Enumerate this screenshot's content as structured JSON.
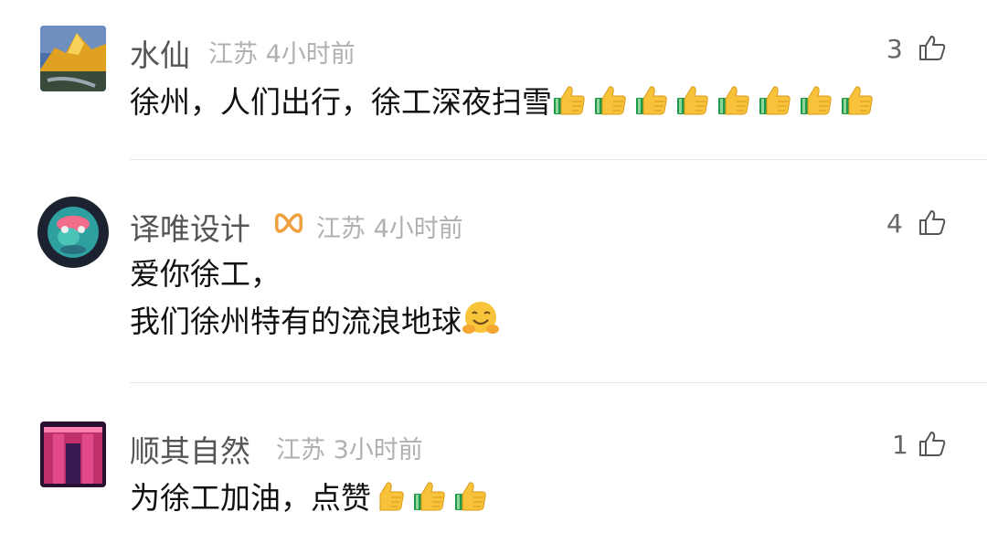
{
  "comments": [
    {
      "name": "水仙",
      "location": "江苏",
      "time": "4小时前",
      "likes": "3",
      "lines": [
        "徐州，人们出行，徐工深夜扫雪"
      ],
      "thumbs_after": 8,
      "avatar_icon": "mountain-landscape-avatar"
    },
    {
      "name": "译唯设计",
      "badge_icon": "verified-badge-icon",
      "location": "江苏",
      "time": "4小时前",
      "likes": "4",
      "lines": [
        "爱你徐工，",
        "我们徐州特有的流浪地球"
      ],
      "emoji_after": "hugging-face-emoji",
      "avatar_icon": "globe-avatar"
    },
    {
      "name": "顺其自然",
      "location": "江苏",
      "time": "3小时前",
      "likes": "1",
      "lines": [
        "为徐工加油，点赞"
      ],
      "thumbs_after": 3,
      "avatar_icon": "neon-building-avatar"
    }
  ],
  "colors": {
    "name": "#555555",
    "meta": "#b0b0b0",
    "text": "#111111",
    "badge": "#f0a040"
  }
}
